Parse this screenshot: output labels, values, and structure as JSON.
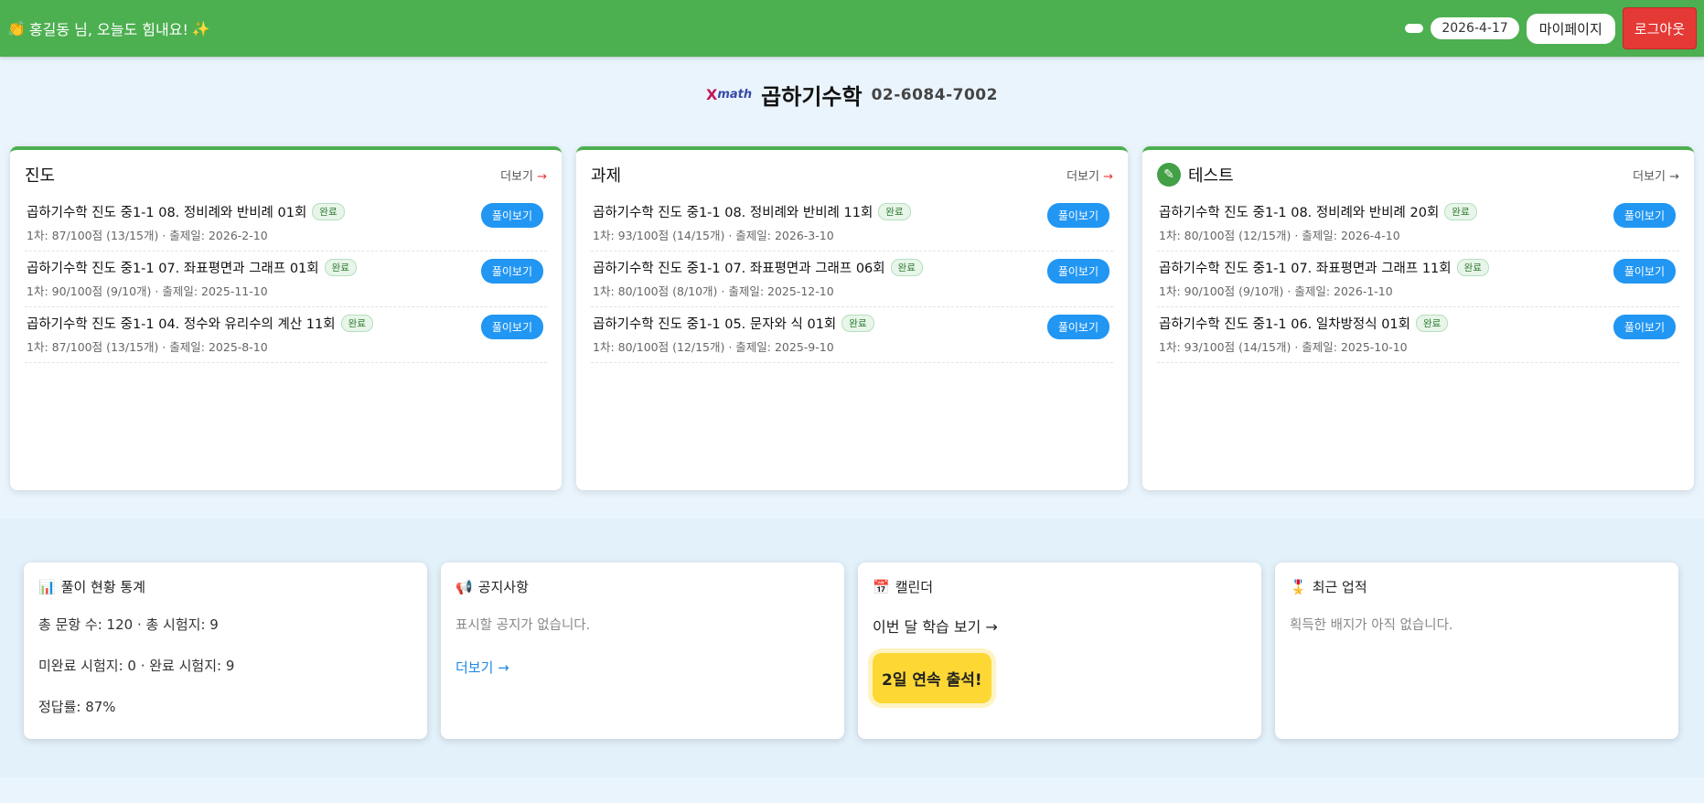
{
  "header": {
    "greeting_icon": "👏",
    "greeting": "홍길동 님, 오늘도 힘내요!",
    "greeting_sparkle": "✨",
    "date": "2026-4-17",
    "mypage_label": "마이페이지",
    "logout_label": "로그아웃",
    "bar_color": "#4caf50"
  },
  "brand": {
    "logo_x": "X",
    "logo_math": "math",
    "name": "곱하기수학",
    "phone": "02-6084-7002"
  },
  "cards": [
    {
      "title": "진도",
      "more": "더보기",
      "items": [
        {
          "title": "곱하기수학 진도 중1-1 08. 정비례와 반비례 01회",
          "badge": "완료",
          "sub": "1차: 87/100점 (13/15개) · 출제일: 2026-2-10",
          "button": "풀이보기"
        },
        {
          "title": "곱하기수학 진도 중1-1 07. 좌표평면과 그래프 01회",
          "badge": "완료",
          "sub": "1차: 90/100점 (9/10개) · 출제일: 2025-11-10",
          "button": "풀이보기"
        },
        {
          "title": "곱하기수학 진도 중1-1 04. 정수와 유리수의 계산 11회",
          "badge": "완료",
          "sub": "1차: 87/100점 (13/15개) · 출제일: 2025-8-10",
          "button": "풀이보기"
        }
      ]
    },
    {
      "title": "과제",
      "more": "더보기",
      "items": [
        {
          "title": "곱하기수학 진도 중1-1 08. 정비례와 반비례 11회",
          "badge": "완료",
          "sub": "1차: 93/100점 (14/15개) · 출제일: 2026-3-10",
          "button": "풀이보기"
        },
        {
          "title": "곱하기수학 진도 중1-1 07. 좌표평면과 그래프 06회",
          "badge": "완료",
          "sub": "1차: 80/100점 (8/10개) · 출제일: 2025-12-10",
          "button": "풀이보기"
        },
        {
          "title": "곱하기수학 진도 중1-1 05. 문자와 식 01회",
          "badge": "완료",
          "sub": "1차: 80/100점 (12/15개) · 출제일: 2025-9-10",
          "button": "풀이보기"
        }
      ]
    },
    {
      "title": "테스트",
      "icon": "pencil-icon",
      "more": "더보기",
      "items": [
        {
          "title": "곱하기수학 진도 중1-1 08. 정비례와 반비례 20회",
          "badge": "완료",
          "sub": "1차: 80/100점 (12/15개) · 출제일: 2026-4-10",
          "button": "풀이보기"
        },
        {
          "title": "곱하기수학 진도 중1-1 07. 좌표평면과 그래프 11회",
          "badge": "완료",
          "sub": "1차: 90/100점 (9/10개) · 출제일: 2026-1-10",
          "button": "풀이보기"
        },
        {
          "title": "곱하기수학 진도 중1-1 06. 일차방정식 01회",
          "badge": "완료",
          "sub": "1차: 93/100점 (14/15개) · 출제일: 2025-10-10",
          "button": "풀이보기"
        }
      ]
    }
  ],
  "stats": {
    "icon": "📊",
    "title": "풀이 현황 통계",
    "line1": "총 문항 수: 120 · 총 시험지: 9",
    "line2": "미완료 시험지: 0 · 완료 시험지: 9",
    "line3": "정답률: 87%"
  },
  "notice": {
    "icon": "📢",
    "title": "공지사항",
    "empty": "표시할 공지가 없습니다.",
    "more": "더보기 →"
  },
  "calendar": {
    "icon": "📅",
    "title": "캘린더",
    "link": "이번 달 학습 보기 →",
    "streak": "2일 연속 출석!"
  },
  "achievements": {
    "icon": "🎖️",
    "title": "최근 업적",
    "empty": "획득한 배지가 아직 없습니다."
  }
}
